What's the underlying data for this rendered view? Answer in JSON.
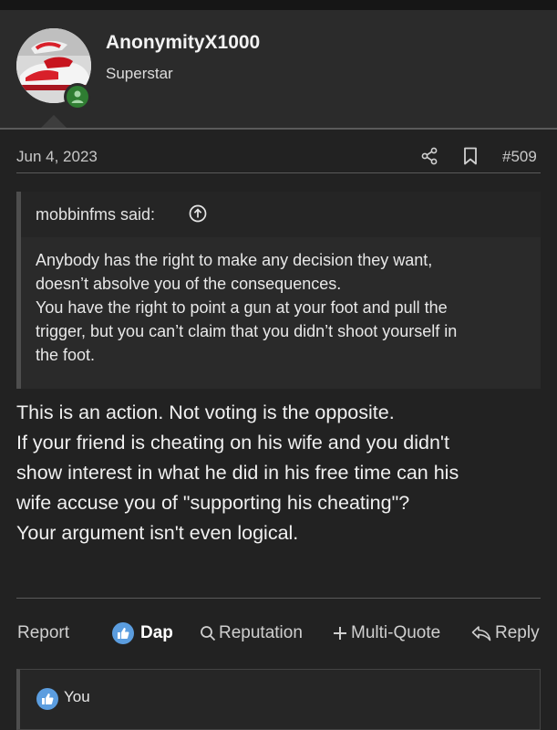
{
  "user": {
    "username": "AnonymityX1000",
    "title": "Superstar",
    "avatar_icon": "sneaker-avatar",
    "status_icon": "online-status-icon",
    "status_color": "#2f7d32"
  },
  "post": {
    "date": "Jun 4, 2023",
    "number": "#509",
    "quote": {
      "author": "mobbinfms said:",
      "lines": [
        "Anybody has the right to make any decision they want,",
        "doesn’t absolve you of the consequences.",
        "You have the right to point a gun at your foot and pull the",
        "trigger, but you can’t claim that you didn’t shoot yourself in",
        "the foot."
      ]
    },
    "body_lines": [
      "This is an action. Not voting is the opposite.",
      "If your friend is cheating on his wife and you didn't",
      "show interest in what he did in his free time can his",
      "wife accuse you of \"supporting his cheating\"?",
      "Your argument isn't even logical."
    ]
  },
  "actions": {
    "report": "Report",
    "dap": "Dap",
    "reputation": "Reputation",
    "multi_quote": "Multi-Quote",
    "reply": "Reply"
  },
  "reactions": {
    "who": "You"
  },
  "colors": {
    "accent": "#5b9ddf",
    "background": "#222222",
    "header": "#2b2b2b"
  }
}
